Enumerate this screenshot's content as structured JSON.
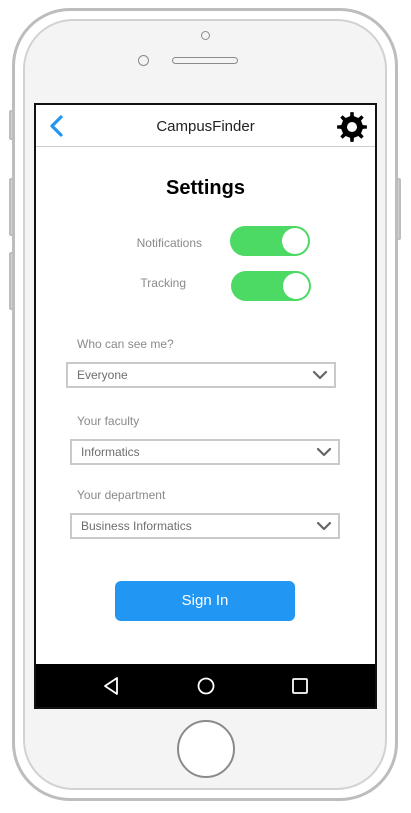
{
  "app": {
    "title": "CampusFinder"
  },
  "header": {
    "back_icon": "chevron-left-icon",
    "settings_icon": "gear-icon"
  },
  "settings": {
    "title": "Settings",
    "toggles": [
      {
        "label": "Notifications",
        "on": true
      },
      {
        "label": "Tracking",
        "on": true
      }
    ],
    "visibility": {
      "label": "Who can see me?",
      "value": "Everyone"
    },
    "faculty": {
      "label": "Your faculty",
      "value": "Informatics"
    },
    "department": {
      "label": "Your department",
      "value": "Business Informatics"
    },
    "sign_in_label": "Sign In"
  },
  "nav": {
    "back_icon": "triangle-back-icon",
    "home_icon": "circle-home-icon",
    "recents_icon": "square-recents-icon"
  },
  "colors": {
    "accent": "#2196f3",
    "toggle_on": "#4cd964",
    "back_arrow": "#2196f3",
    "navbar": "#000000"
  }
}
